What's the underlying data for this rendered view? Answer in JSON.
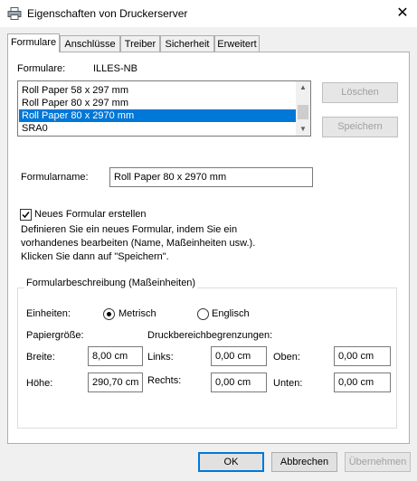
{
  "window": {
    "title": "Eigenschaften von Druckerserver",
    "icon": "printer-icon",
    "close_icon": "close-icon"
  },
  "tabs": [
    {
      "label": "Formulare",
      "active": true
    },
    {
      "label": "Anschlüsse",
      "active": false
    },
    {
      "label": "Treiber",
      "active": false
    },
    {
      "label": "Sicherheit",
      "active": false
    },
    {
      "label": "Erweitert",
      "active": false
    }
  ],
  "forms": {
    "label": "Formulare:",
    "server": "ILLES-NB",
    "items": [
      "Roll Paper 58 x 297 mm",
      "Roll Paper 80 x 297 mm",
      "Roll Paper 80 x 2970 mm",
      "SRA0"
    ],
    "selected_index": 2,
    "delete_label": "Löschen",
    "save_label": "Speichern"
  },
  "form_name": {
    "label": "Formularname:",
    "value": "Roll Paper 80 x 2970 mm"
  },
  "new_form": {
    "checkbox_label": "Neues Formular erstellen",
    "checked": true,
    "desc_line1": "Definieren Sie ein neues Formular, indem Sie ein",
    "desc_line2": "vorhandenes bearbeiten (Name, Maßeinheiten usw.).",
    "desc_line3": "Klicken Sie dann auf \"Speichern\"."
  },
  "description": {
    "group_title": "Formularbeschreibung (Maßeinheiten)",
    "units_label": "Einheiten:",
    "metric_label": "Metrisch",
    "english_label": "Englisch",
    "metric_selected": true,
    "paper_size_label": "Papiergröße:",
    "print_area_label": "Druckbereichbegrenzungen:",
    "width_label": "Breite:",
    "width_value": "8,00 cm",
    "height_label": "Höhe:",
    "height_value": "290,70 cm",
    "left_label": "Links:",
    "left_value": "0,00 cm",
    "right_label": "Rechts:",
    "right_value": "0,00 cm",
    "top_label": "Oben:",
    "top_value": "0,00 cm",
    "bottom_label": "Unten:",
    "bottom_value": "0,00 cm"
  },
  "footer": {
    "ok_label": "OK",
    "cancel_label": "Abbrechen",
    "apply_label": "Übernehmen"
  },
  "colors": {
    "selection": "#0078d7",
    "dialog_bg": "#f0f0f0"
  }
}
